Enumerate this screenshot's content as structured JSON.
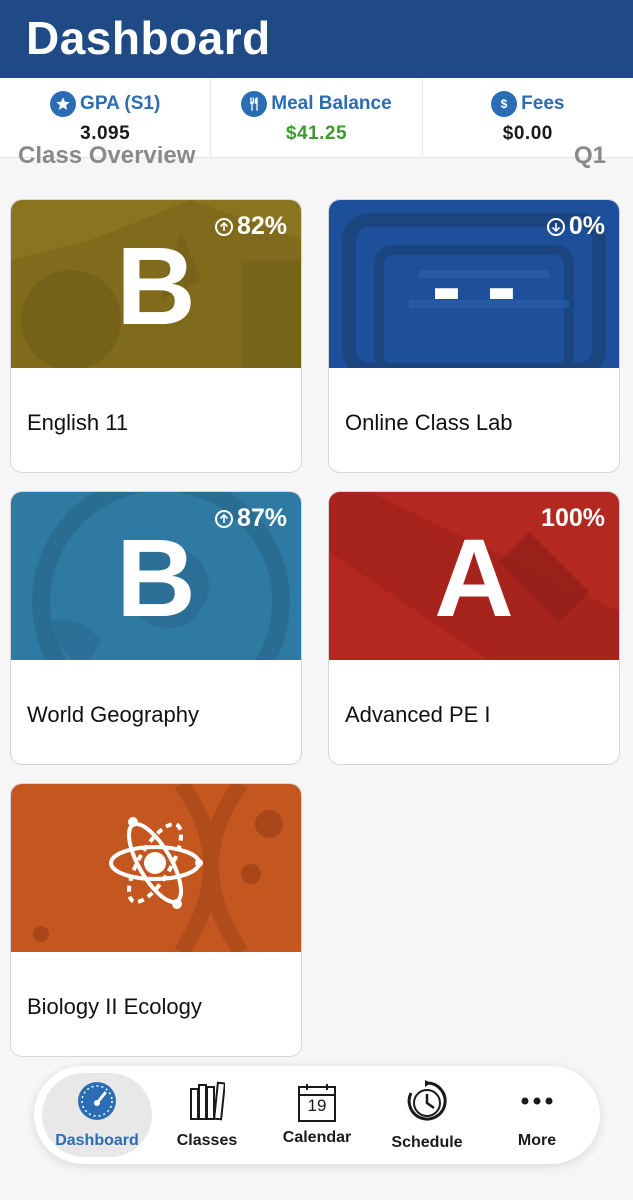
{
  "header": {
    "title": "Dashboard"
  },
  "stats": [
    {
      "label": "GPA (S1)",
      "value": "3.095",
      "icon": "star-icon"
    },
    {
      "label": "Meal Balance",
      "value": "$41.25",
      "icon": "utensils-icon"
    },
    {
      "label": "Fees",
      "value": "$0.00",
      "icon": "dollar-icon"
    }
  ],
  "overview": {
    "title": "Class Overview",
    "quarter": "Q1"
  },
  "classes": [
    {
      "name": "English 11",
      "grade": "B",
      "percent": "82%",
      "trend": "up",
      "color": "#8a7420"
    },
    {
      "name": "Online Class Lab",
      "grade": "- -",
      "percent": "0%",
      "trend": "down",
      "color": "#1e4f9a"
    },
    {
      "name": "World Geography",
      "grade": "B",
      "percent": "87%",
      "trend": "up",
      "color": "#2f7aa3"
    },
    {
      "name": "Advanced PE I",
      "grade": "A",
      "percent": "100%",
      "trend": "none",
      "color": "#b3281f"
    },
    {
      "name": "Biology II Ecology",
      "grade": "",
      "percent": "",
      "trend": "none",
      "color": "#c4571f",
      "icon": "atom-icon"
    }
  ],
  "nav": [
    {
      "label": "Dashboard",
      "icon": "gauge-icon",
      "active": true
    },
    {
      "label": "Classes",
      "icon": "books-icon",
      "active": false
    },
    {
      "label": "Calendar",
      "icon": "calendar-icon",
      "active": false,
      "calendar_day": "19"
    },
    {
      "label": "Schedule",
      "icon": "clock-icon",
      "active": false
    },
    {
      "label": "More",
      "icon": "more-icon",
      "active": false
    }
  ]
}
